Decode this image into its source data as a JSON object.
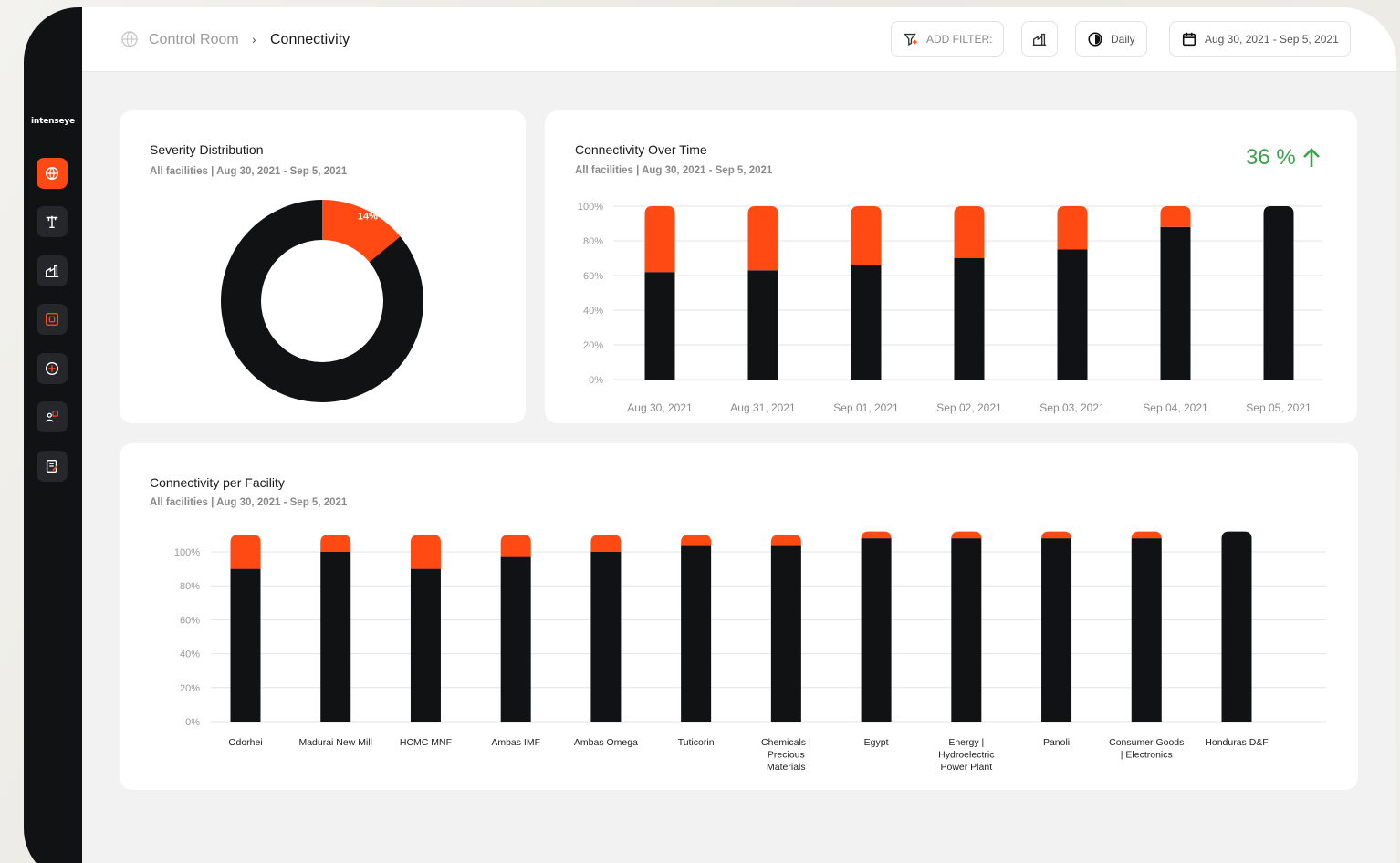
{
  "app": {
    "logo": "intenseye"
  },
  "breadcrumb": {
    "root": "Control Room",
    "separator": "›",
    "current": "Connectivity"
  },
  "toolbar": {
    "add_filter": "ADD FILTER:",
    "period": "Daily",
    "date_range": "Aug 30, 2021 - Sep 5, 2021"
  },
  "colors": {
    "accent": "#ff4a14",
    "dark": "#111214",
    "positive": "#3aa34a"
  },
  "sidebar": {
    "items": [
      "globe-icon",
      "crane-icon",
      "factory-icon",
      "camera-icon",
      "target-icon",
      "people-icon",
      "report-icon"
    ]
  },
  "severity": {
    "title": "Severity Distribution",
    "subtitle": "All facilities | Aug 30, 2021 - Sep 5, 2021"
  },
  "over_time": {
    "title": "Connectivity Over Time",
    "subtitle": "All facilities | Aug 30, 2021 - Sep 5, 2021",
    "kpi": "36 %"
  },
  "per_facility": {
    "title": "Connectivity per Facility",
    "subtitle": "All facilities | Aug 30, 2021 - Sep 5, 2021"
  },
  "chart_data": [
    {
      "type": "pie",
      "labels": [
        "14%",
        "86%"
      ],
      "values": [
        14,
        86
      ],
      "colors": [
        "#ff4a14",
        "#111214"
      ]
    },
    {
      "type": "bar",
      "stacked": true,
      "categories": [
        "Aug 30, 2021",
        "Aug 31, 2021",
        "Sep 01, 2021",
        "Sep 02, 2021",
        "Sep 03, 2021",
        "Sep 04, 2021",
        "Sep 05, 2021"
      ],
      "series": [
        {
          "values": [
            62,
            63,
            66,
            70,
            75,
            88,
            100
          ],
          "color": "#111214"
        },
        {
          "values": [
            38,
            37,
            34,
            30,
            25,
            12,
            0
          ],
          "color": "#ff4a14"
        }
      ],
      "yticks": [
        "100%",
        "80%",
        "60%",
        "40%",
        "20%",
        "0%"
      ],
      "ylim": [
        0,
        100
      ],
      "grid": true
    },
    {
      "type": "bar",
      "stacked": true,
      "categories": [
        [
          "Odorhei"
        ],
        [
          "Madurai New Mill"
        ],
        [
          "HCMC MNF"
        ],
        [
          "Ambas IMF"
        ],
        [
          "Ambas Omega"
        ],
        [
          "Tuticorin"
        ],
        [
          "Chemicals |",
          "Precious",
          "Materials"
        ],
        [
          "Egypt"
        ],
        [
          "Energy |",
          "Hydroelectric",
          "Power Plant"
        ],
        [
          "Panoli"
        ],
        [
          "Consumer Goods",
          "| Electronics"
        ],
        [
          "Honduras D&F"
        ]
      ],
      "series": [
        {
          "values": [
            90,
            100,
            90,
            97,
            100,
            104,
            104,
            108,
            108,
            108,
            108,
            112
          ],
          "color": "#111214"
        },
        {
          "values": [
            20,
            10,
            20,
            13,
            10,
            6,
            6,
            4,
            4,
            4,
            4,
            0
          ],
          "color": "#ff4a14"
        }
      ],
      "yticks": [
        "100%",
        "80%",
        "60%",
        "40%",
        "20%",
        "0%"
      ],
      "ylim": [
        0,
        100
      ],
      "grid": true
    }
  ]
}
